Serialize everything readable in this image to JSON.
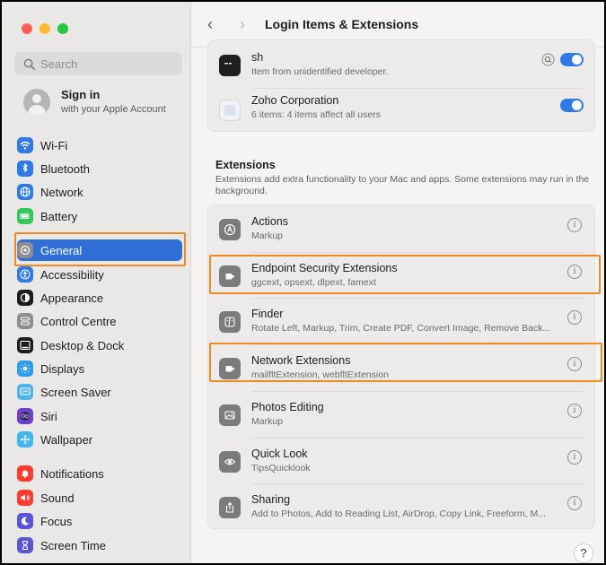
{
  "window": {
    "title": "Login Items & Extensions"
  },
  "sidebar": {
    "search_placeholder": "Search",
    "account": {
      "name": "Sign in",
      "subtitle": "with your Apple Account"
    },
    "items": [
      {
        "label": "Wi-Fi",
        "icon": "wifi-icon",
        "color": "#2f7ae6"
      },
      {
        "label": "Bluetooth",
        "icon": "bluetooth-icon",
        "color": "#2f7ae6"
      },
      {
        "label": "Network",
        "icon": "globe-icon",
        "color": "#2f7ae6"
      },
      {
        "label": "Battery",
        "icon": "battery-icon",
        "color": "#34c759"
      },
      {
        "label": "General",
        "icon": "gear-icon",
        "color": "#8e8e93"
      },
      {
        "label": "Accessibility",
        "icon": "accessibility-icon",
        "color": "#2f7ae6"
      },
      {
        "label": "Appearance",
        "icon": "appearance-icon",
        "color": "#1d1d1f"
      },
      {
        "label": "Control Centre",
        "icon": "control-centre-icon",
        "color": "#8e8e93"
      },
      {
        "label": "Desktop & Dock",
        "icon": "dock-icon",
        "color": "#1d1d1f"
      },
      {
        "label": "Displays",
        "icon": "sun-icon",
        "color": "#2f9bf0"
      },
      {
        "label": "Screen Saver",
        "icon": "screen-saver-icon",
        "color": "#4fb4e8"
      },
      {
        "label": "Siri",
        "icon": "siri-icon",
        "color": "#6a3fd1"
      },
      {
        "label": "Wallpaper",
        "icon": "wallpaper-icon",
        "color": "#3fb6f0"
      },
      {
        "label": "Notifications",
        "icon": "bell-icon",
        "color": "#ff3b30"
      },
      {
        "label": "Sound",
        "icon": "speaker-icon",
        "color": "#ff3b30"
      },
      {
        "label": "Focus",
        "icon": "moon-icon",
        "color": "#5856d6"
      },
      {
        "label": "Screen Time",
        "icon": "hourglass-icon",
        "color": "#5856d6"
      }
    ],
    "selected": "General"
  },
  "login_items": [
    {
      "name": "sh",
      "detail": "Item from unidentified developer.",
      "enabled": true
    },
    {
      "name": "Zoho Corporation",
      "detail": "6 items: 4 items affect all users",
      "enabled": true
    }
  ],
  "extensions": {
    "title": "Extensions",
    "description": "Extensions add extra functionality to your Mac and apps. Some extensions may run in the background.",
    "items": [
      {
        "name": "Actions",
        "detail": "Markup",
        "icon": "actions-icon"
      },
      {
        "name": "Endpoint Security Extensions",
        "detail": "ggcext, opsext, dlpext, famext",
        "icon": "extension-icon"
      },
      {
        "name": "Finder",
        "detail": "Rotate Left, Markup, Trim, Create PDF, Convert Image, Remove Back...",
        "icon": "finder-icon"
      },
      {
        "name": "Network Extensions",
        "detail": "mailfltExtension, webfltExtension",
        "icon": "extension-icon"
      },
      {
        "name": "Photos Editing",
        "detail": "Markup",
        "icon": "photos-icon"
      },
      {
        "name": "Quick Look",
        "detail": "TipsQuicklook",
        "icon": "eye-icon"
      },
      {
        "name": "Sharing",
        "detail": "Add to Photos, Add to Reading List, AirDrop, Copy Link, Freeform, M...",
        "icon": "share-icon"
      }
    ]
  },
  "help_label": "?",
  "info_glyph": "i",
  "colors": {
    "accent": "#2f6fd6",
    "highlight": "#f08a24",
    "toggle_on": "#2f7ae6"
  }
}
